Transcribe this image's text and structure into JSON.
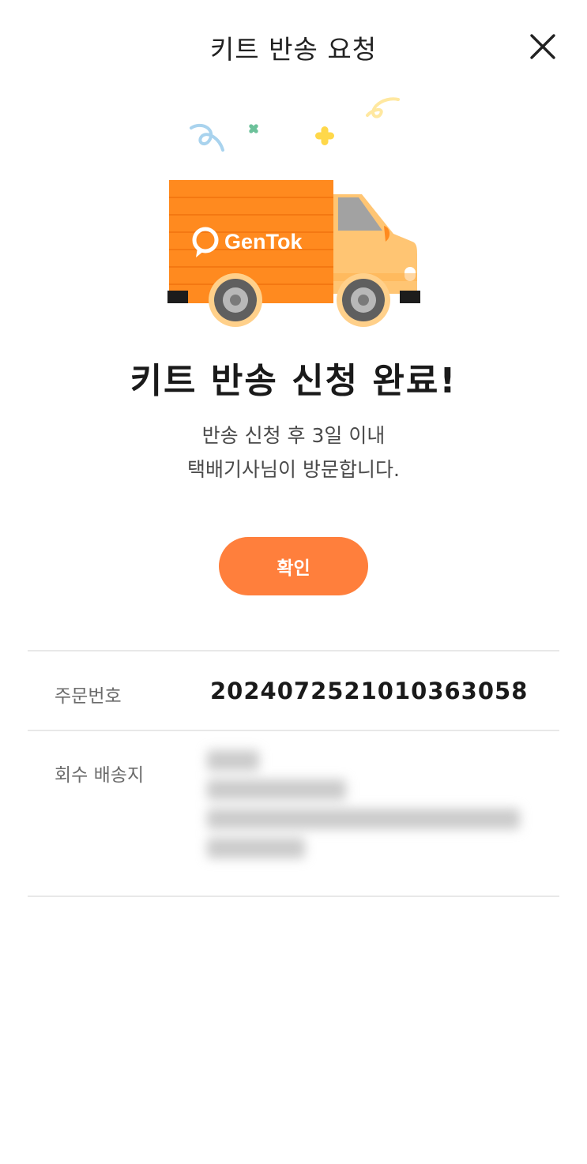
{
  "header": {
    "title": "키트 반송 요청",
    "close_icon": "close-icon"
  },
  "illustration": {
    "brand_logo_text": "GenTok",
    "truck_color": "#ff8a1f",
    "cab_color": "#ffc573",
    "icon": "delivery-truck-icon"
  },
  "complete": {
    "title": "키트 반송 신청 완료!",
    "desc_line1": "반송 신청 후 3일 이내",
    "desc_line2": "택배기사님이 방문합니다."
  },
  "confirm_button": {
    "label": "확인",
    "color": "#ff7f3c"
  },
  "details": {
    "order_number_label": "주문번호",
    "order_number_value": "20240725210103630​58",
    "return_address_label": "회수 배송지"
  }
}
